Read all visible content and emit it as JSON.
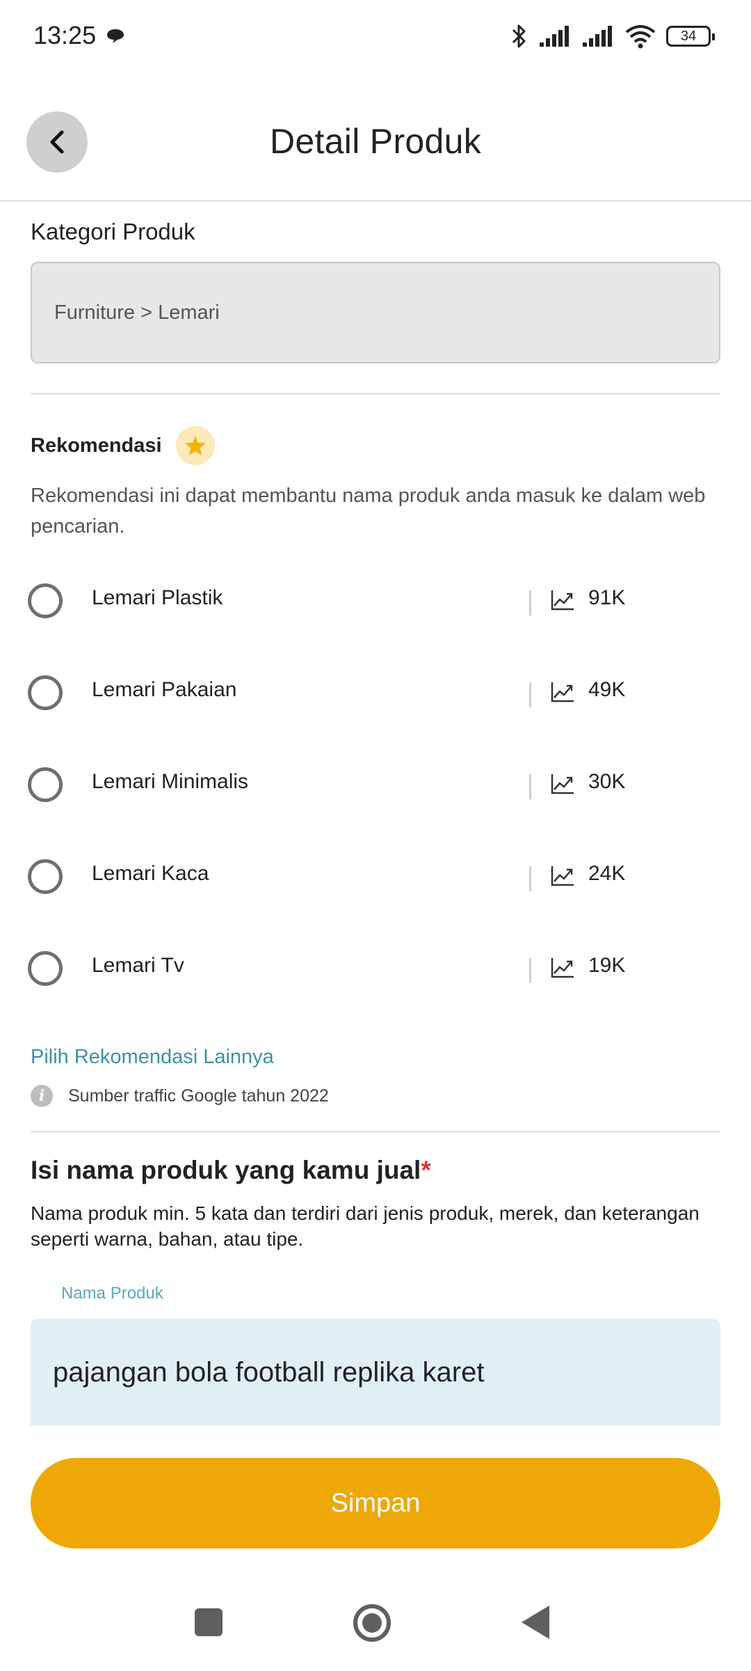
{
  "status_bar": {
    "time": "13:25",
    "battery": "34",
    "icons": [
      "chat-icon",
      "bluetooth-icon",
      "signal-icon",
      "signal-icon",
      "wifi-icon",
      "battery-icon"
    ]
  },
  "header": {
    "title": "Detail Produk",
    "back_icon": "chevron-left-icon"
  },
  "category": {
    "title": "Kategori Produk",
    "value": "Furniture > Lemari"
  },
  "recommendation": {
    "title": "Rekomendasi",
    "description": "Rekomendasi ini dapat membantu nama produk anda masuk ke dalam web pencarian.",
    "items": [
      {
        "label": "Lemari Plastik",
        "count": "91K"
      },
      {
        "label": "Lemari Pakaian",
        "count": "49K"
      },
      {
        "label": "Lemari Minimalis",
        "count": "30K"
      },
      {
        "label": "Lemari Kaca",
        "count": "24K"
      },
      {
        "label": "Lemari Tv",
        "count": "19K"
      }
    ],
    "more_link": "Pilih Rekomendasi Lainnya",
    "source_note": "Sumber traffic Google tahun 2022"
  },
  "product_name": {
    "title": "Isi nama produk yang kamu jual",
    "required_mark": "*",
    "description": "Nama produk min. 5 kata dan terdiri dari jenis produk, merek, dan keterangan seperti warna, bahan, atau tipe.",
    "field_label": "Nama Produk",
    "value": "pajangan bola football replika karet"
  },
  "save_label": "Simpan",
  "colors": {
    "accent": "#eea706",
    "link": "#3b93a6",
    "star": "#f2b400",
    "required": "#e0343a"
  }
}
